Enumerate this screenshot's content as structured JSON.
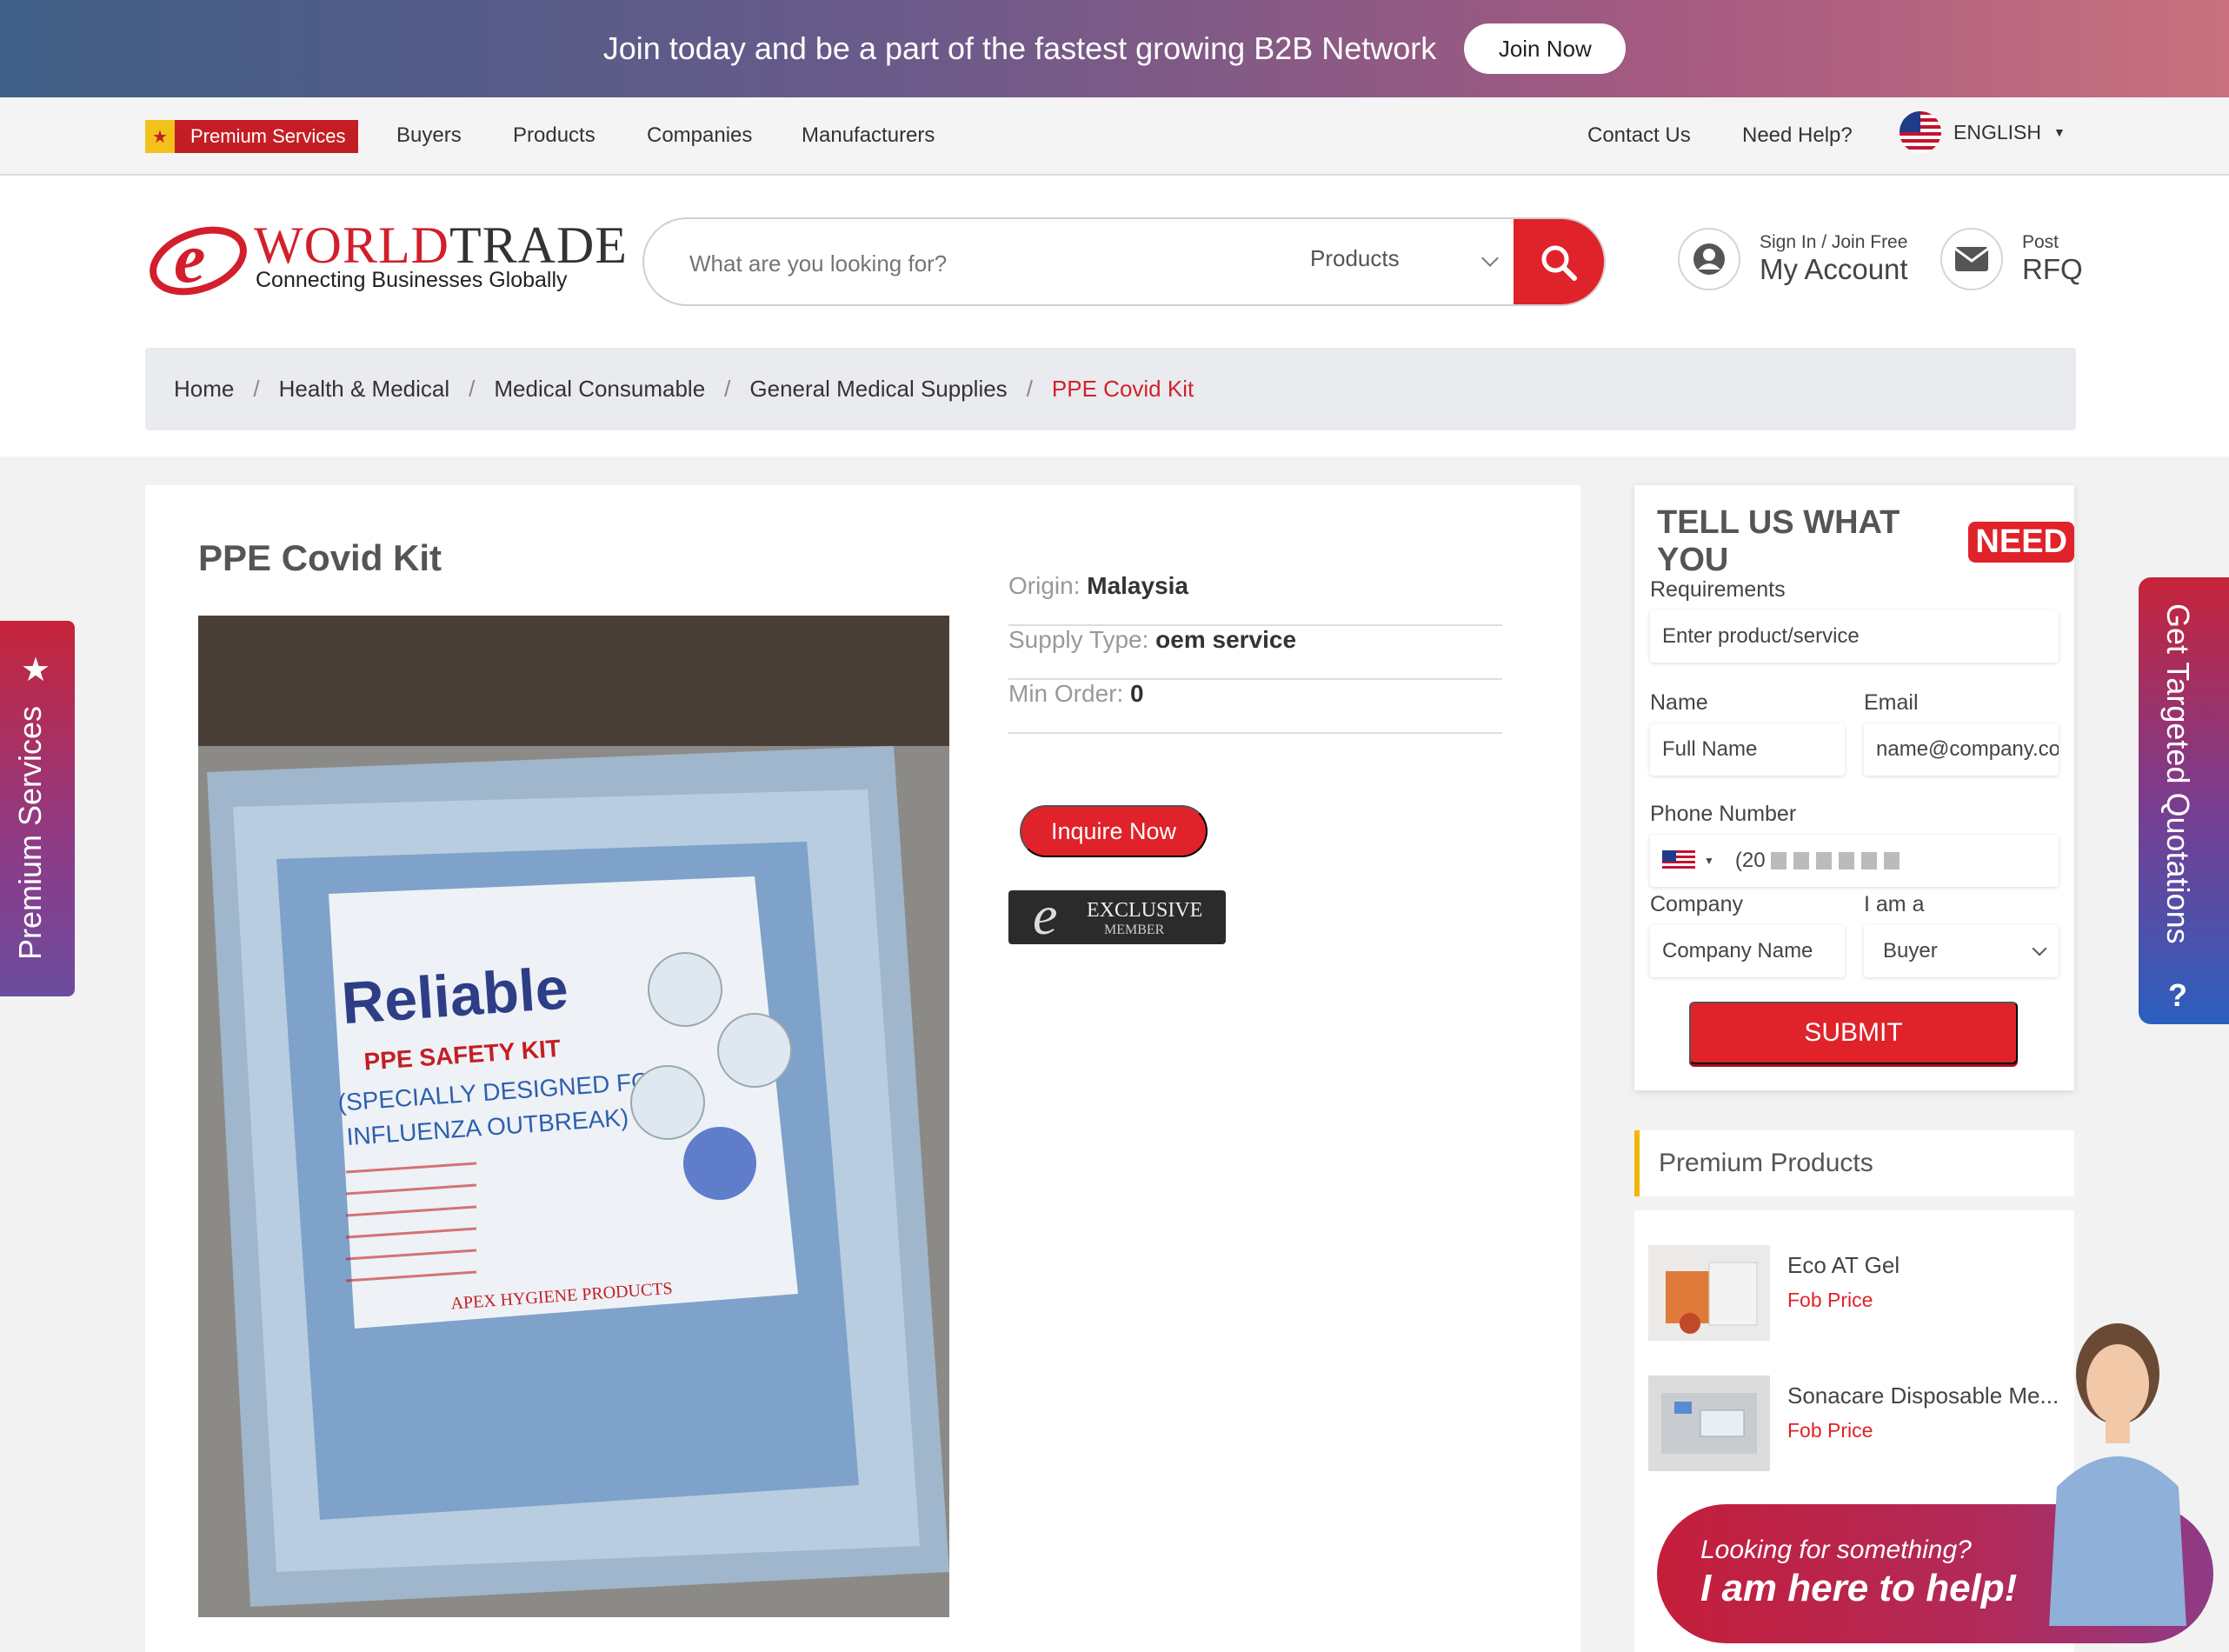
{
  "banner": {
    "text": "Join today and be a part of the fastest growing B2B Network",
    "button": "Join Now"
  },
  "nav": {
    "premium": "Premium Services",
    "links": [
      "Buyers",
      "Products",
      "Companies",
      "Manufacturers"
    ],
    "right_links": [
      "Contact Us",
      "Need Help?"
    ],
    "language": "ENGLISH"
  },
  "logo": {
    "word_prefix": "WORLD",
    "word_suffix": "TRADE",
    "tagline": "Connecting Businesses Globally"
  },
  "search": {
    "placeholder": "What are you looking for?",
    "category": "Products"
  },
  "account": {
    "small": "Sign In / Join Free",
    "big": "My Account"
  },
  "rfq": {
    "small": "Post",
    "big": "RFQ"
  },
  "breadcrumb": [
    "Home",
    "Health & Medical",
    "Medical Consumable",
    "General Medical Supplies",
    "PPE Covid Kit"
  ],
  "product": {
    "title": "PPE Covid Kit",
    "origin_label": "Origin:",
    "origin": "Malaysia",
    "supply_label": "Supply Type:",
    "supply": "oem service",
    "min_label": "Min Order:",
    "min": "0",
    "inquire": "Inquire Now",
    "exclusive_line1": "EXCLUSIVE",
    "exclusive_line2": "MEMBER",
    "image_text": {
      "brand": "Reliable",
      "sub1": "PPE SAFETY KIT",
      "sub2": "(SPECIALLY DESIGNED FOR",
      "sub3": "INFLUENZA OUTBREAK)",
      "maker": "APEX HYGIENE PRODUCTS"
    }
  },
  "need_form": {
    "title": "TELL US WHAT YOU",
    "title_highlight": "NEED",
    "requirements_label": "Requirements",
    "requirements_placeholder": "Enter product/service",
    "name_label": "Name",
    "name_placeholder": "Full Name",
    "email_label": "Email",
    "email_placeholder": "name@company.co",
    "phone_label": "Phone Number",
    "phone_value": "(20",
    "company_label": "Company",
    "company_placeholder": "Company Name",
    "role_label": "I am a",
    "role_value": "Buyer",
    "submit": "SUBMIT"
  },
  "premium_products": {
    "heading": "Premium Products",
    "items": [
      {
        "name": "Eco AT Gel",
        "price": "Fob Price"
      },
      {
        "name": "Sonacare Disposable Me...",
        "price": "Fob Price"
      }
    ]
  },
  "side_tabs": {
    "left": "Premium Services",
    "right": "Get Targeted Quotations"
  },
  "help": {
    "small": "Looking for something?",
    "big": "I am here to help!"
  }
}
